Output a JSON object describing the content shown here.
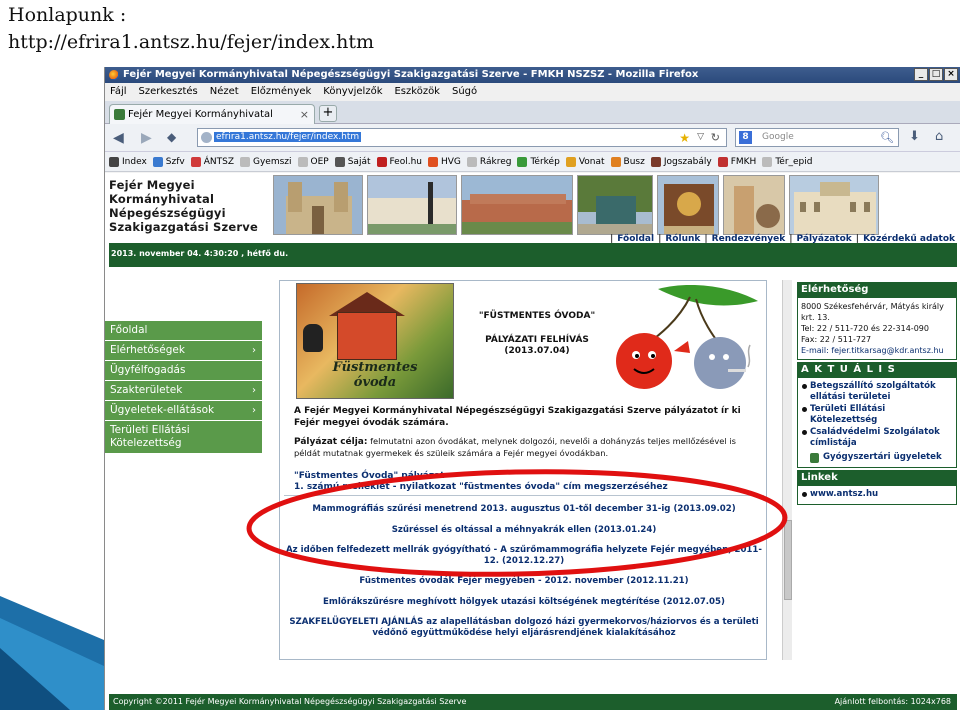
{
  "slide": {
    "title_line1": "Honlapunk :",
    "title_line2": "http://efrira1.antsz.hu/fejer/index.htm"
  },
  "browser": {
    "window_title": "Fejér Megyei Kormányhivatal Népegészségügyi Szakigazgatási Szerve - FMKH NSZSZ - Mozilla Firefox",
    "window_buttons": [
      "_",
      "□",
      "×"
    ],
    "menu": [
      "Fájl",
      "Szerkesztés",
      "Nézet",
      "Előzmények",
      "Könyvjelzők",
      "Eszközök",
      "Súgó"
    ],
    "tab_label": "Fejér Megyei Kormányhivatal Népegészségü...",
    "tab_close": "×",
    "new_tab": "+",
    "url": "efrira1.antsz.hu/fejer/index.htm",
    "search_placeholder": "Google",
    "search_engine_letter": "8",
    "bookmarks": [
      {
        "label": "Index",
        "color": "#444444"
      },
      {
        "label": "Szfv",
        "color": "#3a7ad0"
      },
      {
        "label": "ÁNTSZ",
        "color": "#d03a3a"
      },
      {
        "label": "Gyemszi",
        "color": "#bbbbbb"
      },
      {
        "label": "OEP",
        "color": "#bbbbbb"
      },
      {
        "label": "Saját",
        "color": "#555555"
      },
      {
        "label": "Feol.hu",
        "color": "#c02020"
      },
      {
        "label": "HVG",
        "color": "#e05020"
      },
      {
        "label": "Rákreg",
        "color": "#bbbbbb"
      },
      {
        "label": "Térkép",
        "color": "#3a9a3a"
      },
      {
        "label": "Vonat",
        "color": "#e0a020"
      },
      {
        "label": "Busz",
        "color": "#e08020"
      },
      {
        "label": "Jogszabály",
        "color": "#7a3a2a"
      },
      {
        "label": "FMKH",
        "color": "#c03030"
      },
      {
        "label": "Tér_epid",
        "color": "#bbbbbb"
      }
    ]
  },
  "site": {
    "org_name": "Fejér Megyei Kormányhivatal Népegészségügyi Szakigazgatási Szerve",
    "top_nav": [
      "Főoldal",
      "Rólunk",
      "Rendezvények",
      "Pályázatok",
      "Közérdekű adatok"
    ],
    "date_line": "2013. november 04. 4:30:20 , hétfő du.",
    "left_nav": [
      {
        "label": "Főoldal",
        "arrow": ""
      },
      {
        "label": "Elérhetőségek",
        "arrow": "›"
      },
      {
        "label": "Ügyfélfogadás",
        "arrow": ""
      },
      {
        "label": "Szakterületek",
        "arrow": "›"
      },
      {
        "label": "Ügyeletek-ellátások",
        "arrow": "›"
      },
      {
        "label": "Területi Ellátási Kötelezettség",
        "arrow": ""
      }
    ],
    "poster_text": "Füstmentes óvoda",
    "poster_heading": "\"FÜSTMENTES ÓVODA\"",
    "poster_subheading_1": "PÁLYÁZATI FELHÍVÁS",
    "poster_subheading_2": "(2013.07.04)",
    "intro_bold": "A Fejér Megyei Kormányhivatal Népegészségügyi Szakigazgatási Szerve pályázatot ír ki Fejér megyei óvodák számára.",
    "goal_label": "Pályázat célja:",
    "goal_text": " felmutatni azon óvodákat, melynek dolgozói, nevelői a dohányzás teljes mellőzésével is példát mutatnak gyermekek és szüleik számára a Fejér megyei óvodákban.",
    "smoke_line_1": "\"Füstmentes Óvoda\" pályázat",
    "smoke_line_2": "1. számú melléklet - nyilatkozat \"füstmentes óvoda\" cím megszerzéséhez",
    "news": [
      "Mammográfiás szűrési menetrend 2013. augusztus 01-től december 31-ig (2013.09.02)",
      "Szűréssel és oltással a méhnyakrák ellen (2013.01.24)",
      "Az időben felfedezett mellrák gyógyítható - A szűrőmammográfia helyzete Fejér megyében, 2011-12. (2012.12.27)",
      "Füstmentes óvodák Fejér megyében - 2012. november (2012.11.21)",
      "Emlőrákszűrésre meghívott hölgyek utazási költségének megtérítése (2012.07.05)",
      "SZAKFELÜGYELETI AJÁNLÁS az alapellátásban dolgozó házi gyermekorvos/háziorvos és a területi védőnő együttműködése helyi eljárásrendjének kialakításához"
    ],
    "contact_heading": "Elérhetőség",
    "contact_address": "8000 Székesfehérvár, Mátyás király krt. 13.",
    "contact_tel": "Tel: 22 / 511-720 és 22-314-090",
    "contact_fax": "Fax: 22 / 511-727",
    "contact_email": "E-mail: fejer.titkarsag@kdr.antsz.hu",
    "aktualis_heading": "A K T U Á L I S",
    "aktualis_items": [
      "Betegszállító szolgáltatók ellátási területei",
      "Területi Ellátási Kötelezettség",
      "Családvédelmi Szolgálatok címlistája"
    ],
    "pharmacy_link": "Gyógyszertári ügyeletek",
    "links_heading": "Linkek",
    "links_items": [
      "www.antsz.hu"
    ],
    "footer_copyright": "Copyright ©2011 Fejér Megyei Kormányhivatal Népegészségügyi Szakigazgatási Szerve",
    "footer_resolution": "Ajánlott felbontás: 1024x768"
  },
  "colors": {
    "site_green": "#1c5e2c",
    "nav_green": "#5a9a4a",
    "link_blue": "#0b2f70",
    "highlight_oval": "#e01010",
    "titlebar": "#2b4a7c"
  }
}
